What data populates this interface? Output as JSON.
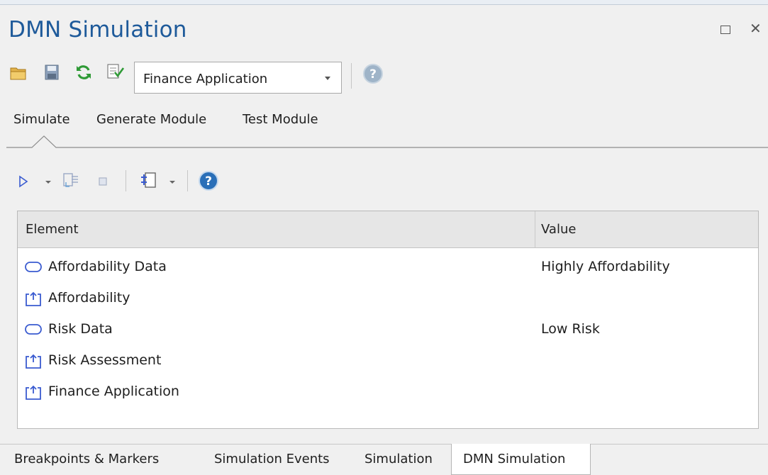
{
  "window": {
    "title": "DMN Simulation"
  },
  "toolbar": {
    "open_icon": "folder-open-icon",
    "save_icon": "save-icon",
    "refresh_icon": "refresh-icon",
    "validate_icon": "validate-icon",
    "model_select": {
      "selected": "Finance Application"
    },
    "help_icon": "help-icon"
  },
  "tabs": [
    {
      "label": "Simulate",
      "active": true
    },
    {
      "label": "Generate Module",
      "active": false
    },
    {
      "label": "Test Module",
      "active": false
    }
  ],
  "sim_toolbar": {
    "run_icon": "play-icon",
    "step_icon": "step-into-icon",
    "stop_icon": "stop-icon",
    "config_icon": "configuration-icon",
    "help_icon": "help-icon"
  },
  "table": {
    "columns": [
      "Element",
      "Value"
    ],
    "rows": [
      {
        "kind": "input-data",
        "name": "Affordability Data",
        "value": "Highly Affordability"
      },
      {
        "kind": "decision",
        "name": "Affordability",
        "value": ""
      },
      {
        "kind": "input-data",
        "name": "Risk Data",
        "value": "Low Risk"
      },
      {
        "kind": "decision",
        "name": "Risk Assessment",
        "value": ""
      },
      {
        "kind": "decision",
        "name": "Finance Application",
        "value": ""
      }
    ]
  },
  "bottom_tabs": [
    {
      "label": "Breakpoints & Markers",
      "active": false
    },
    {
      "label": "Simulation Events",
      "active": false
    },
    {
      "label": "Simulation",
      "active": false
    },
    {
      "label": "DMN Simulation",
      "active": true
    }
  ],
  "colors": {
    "title": "#1e5a9a",
    "icon_blue": "#3a5bd0",
    "header_bg": "#e6e6e6"
  }
}
